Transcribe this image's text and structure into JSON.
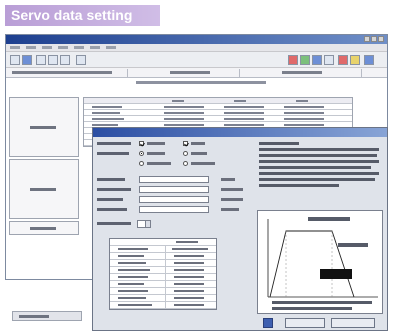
{
  "heading": {
    "text": "Servo data setting"
  },
  "colors": {
    "heading_bg": "#b99ed6",
    "titlebar": "#1d3f8f",
    "dialog_bg": "#dfe3ea",
    "window_bg": "#ffffff"
  },
  "back_window": {
    "icons": [
      "open-icon",
      "save-icon",
      "read-icon",
      "write-icon",
      "verify-icon",
      "print-icon",
      "monitor-icon",
      "help-icon"
    ]
  },
  "dialog": {
    "buttons": [
      {
        "name": "ok-button",
        "icon": "ok-icon"
      },
      {
        "name": "cancel-button",
        "icon": "cancel-icon"
      }
    ]
  }
}
